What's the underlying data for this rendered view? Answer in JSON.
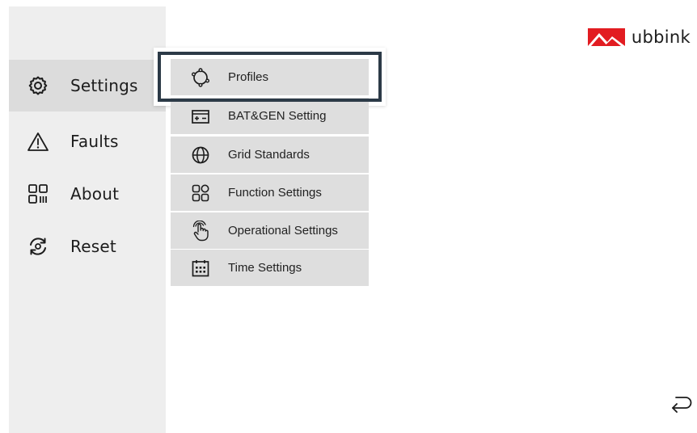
{
  "brand": {
    "name": "ubbink",
    "logo_color": "#e21c21"
  },
  "sidebar": {
    "items": [
      {
        "label": "Settings",
        "icon": "gear-icon",
        "active": true
      },
      {
        "label": "Faults",
        "icon": "warning-icon",
        "active": false
      },
      {
        "label": "About",
        "icon": "grid-icon",
        "active": false
      },
      {
        "label": "Reset",
        "icon": "reset-icon",
        "active": false
      }
    ]
  },
  "submenu": {
    "items": [
      {
        "label": "Profiles",
        "icon": "profiles-icon",
        "highlighted": true
      },
      {
        "label": "BAT&GEN Setting",
        "icon": "battery-icon"
      },
      {
        "label": "Grid Standards",
        "icon": "globe-icon"
      },
      {
        "label": "Function Settings",
        "icon": "function-grid-icon"
      },
      {
        "label": "Operational Settings",
        "icon": "hand-pointer-icon"
      },
      {
        "label": "Time Settings",
        "icon": "calendar-icon"
      }
    ]
  },
  "navigation": {
    "back_icon": "return-icon"
  },
  "colors": {
    "sidebar_bg": "#eeeeee",
    "sidebar_active_bg": "#dcdcdc",
    "submenu_item_bg": "#dedede",
    "highlight_border": "#2c3a47"
  }
}
